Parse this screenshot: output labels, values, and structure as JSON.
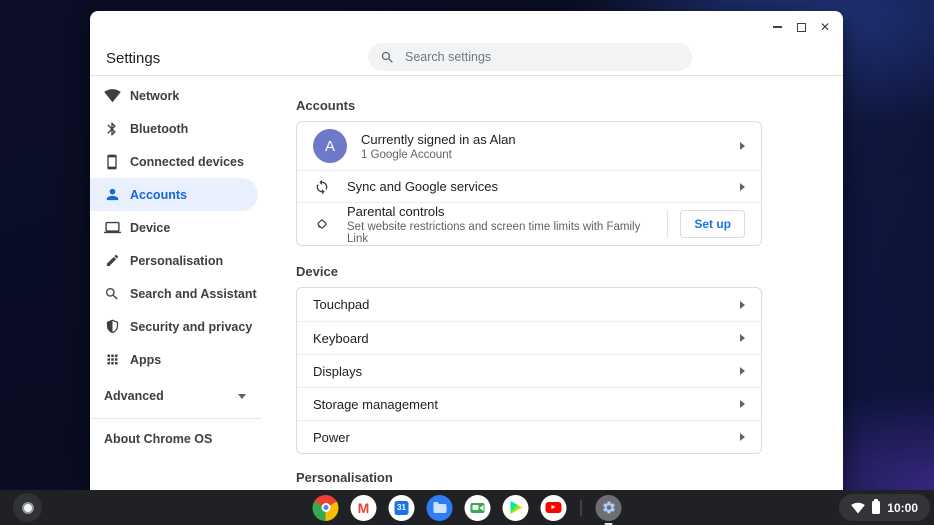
{
  "colors": {
    "accent": "#1a73e8",
    "selected_item_bg": "#e8f0fe",
    "avatar_bg": "#6e79ca",
    "shelf_bg": "#202124",
    "wallpaper_base": "#0a0d22"
  },
  "window": {
    "title": "Settings",
    "search_placeholder": "Search settings",
    "controls": [
      "minimize-icon",
      "maximize-icon",
      "close-icon"
    ]
  },
  "sidebar": {
    "items": [
      {
        "label": "Network",
        "icon": "wifi-icon",
        "selected": false
      },
      {
        "label": "Bluetooth",
        "icon": "bluetooth-icon",
        "selected": false
      },
      {
        "label": "Connected devices",
        "icon": "smartphone-icon",
        "selected": false
      },
      {
        "label": "Accounts",
        "icon": "person-icon",
        "selected": true
      },
      {
        "label": "Device",
        "icon": "laptop-icon",
        "selected": false
      },
      {
        "label": "Personalisation",
        "icon": "pen-icon",
        "selected": false
      },
      {
        "label": "Search and Assistant",
        "icon": "search-icon",
        "selected": false
      },
      {
        "label": "Security and privacy",
        "icon": "shield-icon",
        "selected": false
      },
      {
        "label": "Apps",
        "icon": "apps-grid-icon",
        "selected": false
      }
    ],
    "advanced": {
      "label": "Advanced",
      "icon": "caret-down-icon"
    },
    "about": {
      "label": "About Chrome OS"
    }
  },
  "main": {
    "accounts_section": {
      "heading": "Accounts",
      "signed_in": {
        "avatar_letter": "A",
        "title": "Currently signed in as Alan",
        "subtitle": "1 Google Account"
      },
      "sync": {
        "icon": "sync-icon",
        "title": "Sync and Google services"
      },
      "parental": {
        "icon": "family-link-icon",
        "title": "Parental controls",
        "subtitle": "Set website restrictions and screen time limits with Family Link",
        "button_label": "Set up"
      }
    },
    "device_section": {
      "heading": "Device",
      "rows": [
        {
          "label": "Touchpad"
        },
        {
          "label": "Keyboard"
        },
        {
          "label": "Displays"
        },
        {
          "label": "Storage management"
        },
        {
          "label": "Power"
        }
      ]
    },
    "personalisation_section": {
      "heading": "Personalisation"
    }
  },
  "shelf": {
    "apps": [
      {
        "name": "chrome",
        "icon": "chrome-icon"
      },
      {
        "name": "gmail",
        "icon": "gmail-icon"
      },
      {
        "name": "calendar",
        "icon": "calendar-icon"
      },
      {
        "name": "files",
        "icon": "files-icon"
      },
      {
        "name": "meet",
        "icon": "meet-icon"
      },
      {
        "name": "play-store",
        "icon": "play-store-icon"
      },
      {
        "name": "youtube",
        "icon": "youtube-icon"
      },
      {
        "name": "settings",
        "icon": "settings-gear-icon",
        "active": true
      }
    ],
    "calendar_day": "31",
    "status": {
      "time": "10:00",
      "icons": [
        "wifi-icon",
        "battery-icon"
      ]
    }
  }
}
